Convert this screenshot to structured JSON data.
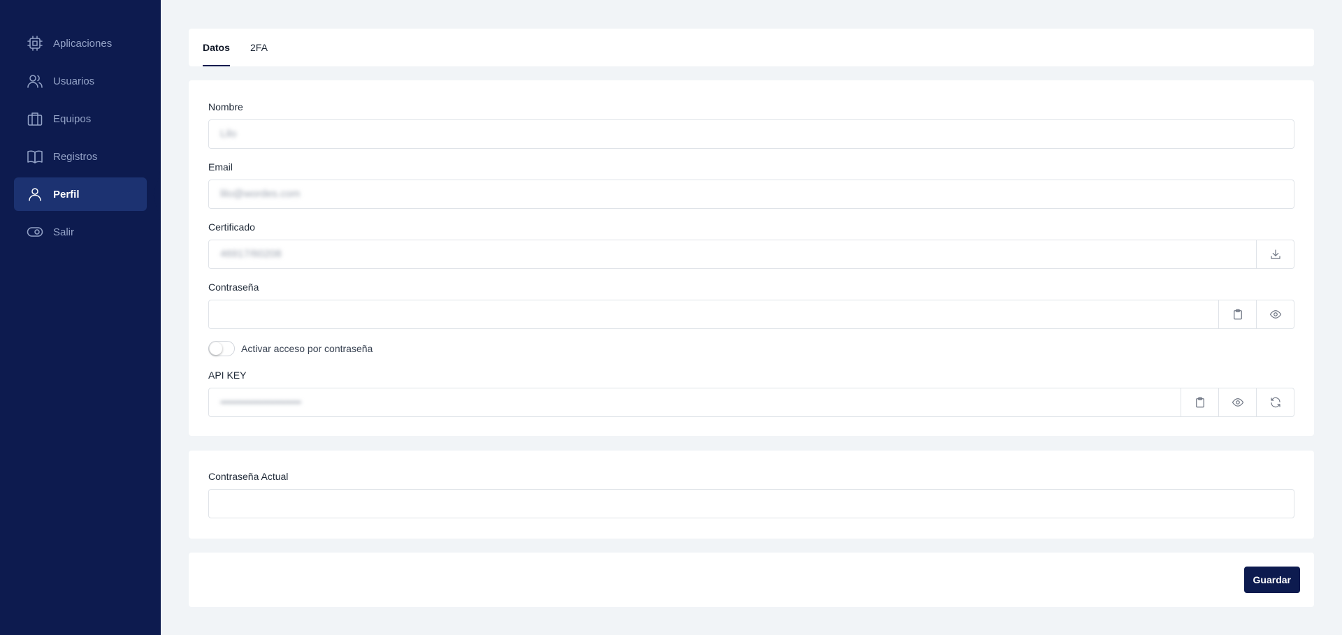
{
  "sidebar": {
    "items": [
      {
        "label": "Aplicaciones",
        "icon": "chip-icon"
      },
      {
        "label": "Usuarios",
        "icon": "users-icon"
      },
      {
        "label": "Equipos",
        "icon": "briefcase-icon"
      },
      {
        "label": "Registros",
        "icon": "book-icon"
      },
      {
        "label": "Perfil",
        "icon": "user-icon",
        "active": true
      },
      {
        "label": "Salir",
        "icon": "toggle-icon"
      }
    ]
  },
  "tabs": [
    {
      "label": "Datos",
      "active": true
    },
    {
      "label": "2FA"
    }
  ],
  "form": {
    "nombre": {
      "label": "Nombre",
      "value": "Lilo"
    },
    "email": {
      "label": "Email",
      "value": "lilo@wordes.com"
    },
    "certificado": {
      "label": "Certificado",
      "value": "46917/60208"
    },
    "contrasena": {
      "label": "Contraseña",
      "value": ""
    },
    "toggle_label": "Activar acceso por contraseña",
    "toggle_on": false,
    "api_key": {
      "label": "API KEY",
      "value": "••••••••••••••••••••••••••••••••••••"
    }
  },
  "current_password": {
    "label": "Contraseña Actual",
    "value": ""
  },
  "actions": {
    "save_label": "Guardar"
  },
  "colors": {
    "sidebar": "#0d1b4f",
    "active_item": "#1c3271",
    "primary": "#0d1b4f",
    "background": "#f1f4f7"
  }
}
